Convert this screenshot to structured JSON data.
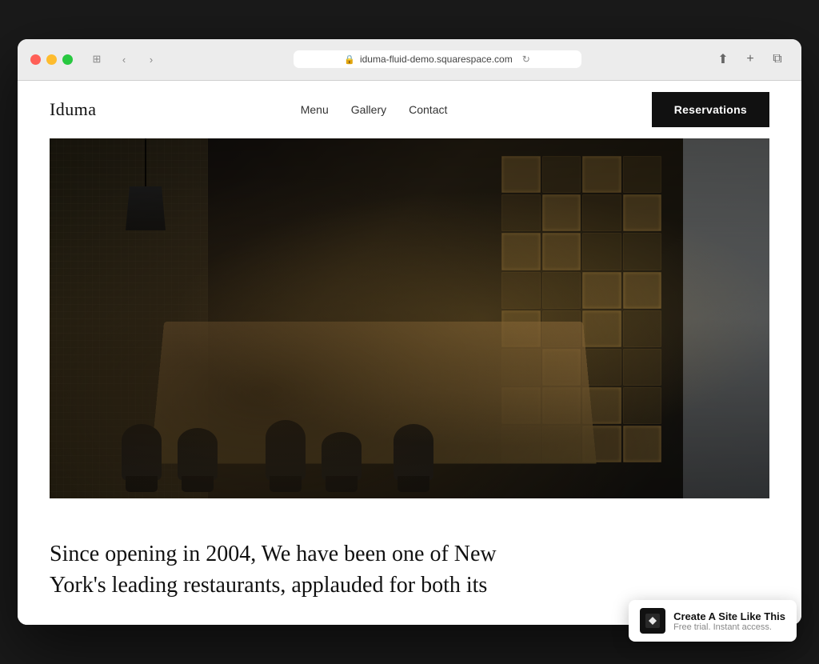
{
  "browser": {
    "url": "iduma-fluid-demo.squarespace.com",
    "back_label": "‹",
    "forward_label": "›",
    "share_label": "⬆",
    "add_tab_label": "+",
    "tabs_label": "⧉"
  },
  "nav": {
    "logo": "Iduma",
    "links": [
      {
        "label": "Menu"
      },
      {
        "label": "Gallery"
      },
      {
        "label": "Contact"
      }
    ],
    "cta_label": "Reservations"
  },
  "hero": {
    "alt": "Restaurant interior with wine rack and dining tables"
  },
  "body": {
    "paragraph_line1": "Since opening in 2004, We have been one of New",
    "paragraph_line2": "York's leading restaurants, applauded for both its"
  },
  "squarespace_badge": {
    "logo_char": "◼",
    "title": "Create A Site Like This",
    "subtitle": "Free trial. Instant access."
  }
}
